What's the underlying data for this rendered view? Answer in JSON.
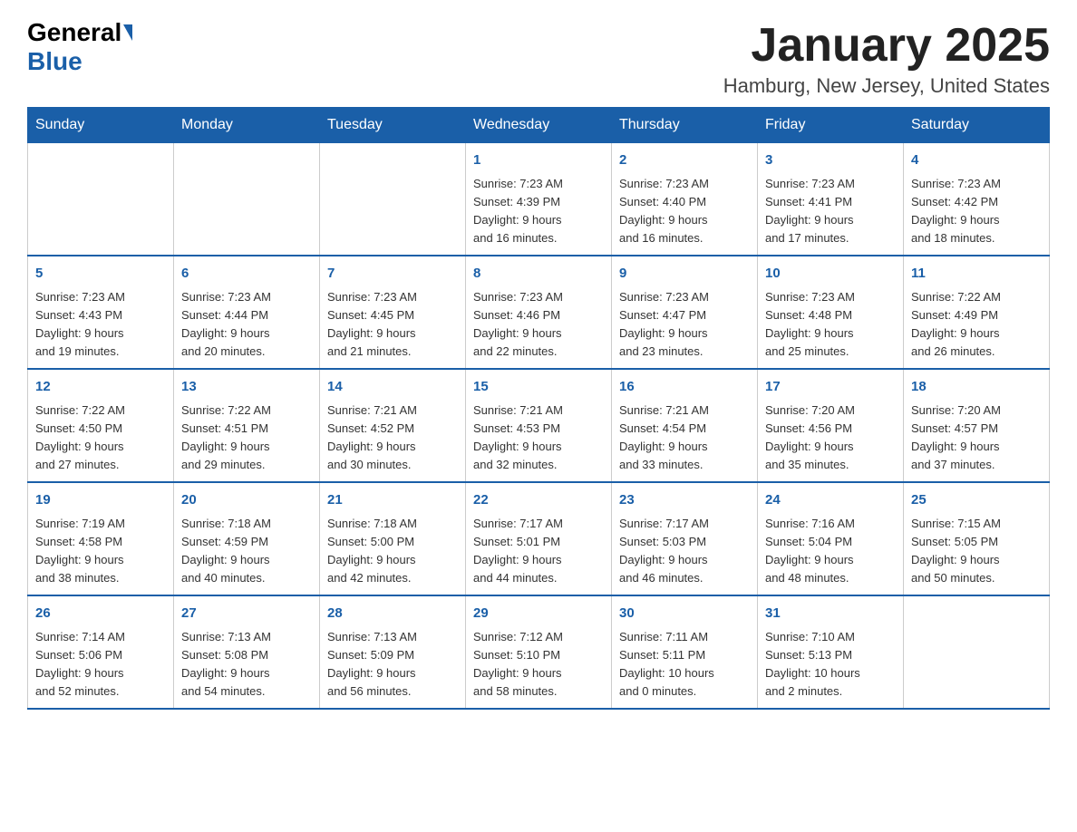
{
  "logo": {
    "general": "General",
    "blue": "Blue"
  },
  "header": {
    "month": "January 2025",
    "location": "Hamburg, New Jersey, United States"
  },
  "weekdays": [
    "Sunday",
    "Monday",
    "Tuesday",
    "Wednesday",
    "Thursday",
    "Friday",
    "Saturday"
  ],
  "weeks": [
    [
      {
        "day": "",
        "info": ""
      },
      {
        "day": "",
        "info": ""
      },
      {
        "day": "",
        "info": ""
      },
      {
        "day": "1",
        "info": "Sunrise: 7:23 AM\nSunset: 4:39 PM\nDaylight: 9 hours\nand 16 minutes."
      },
      {
        "day": "2",
        "info": "Sunrise: 7:23 AM\nSunset: 4:40 PM\nDaylight: 9 hours\nand 16 minutes."
      },
      {
        "day": "3",
        "info": "Sunrise: 7:23 AM\nSunset: 4:41 PM\nDaylight: 9 hours\nand 17 minutes."
      },
      {
        "day": "4",
        "info": "Sunrise: 7:23 AM\nSunset: 4:42 PM\nDaylight: 9 hours\nand 18 minutes."
      }
    ],
    [
      {
        "day": "5",
        "info": "Sunrise: 7:23 AM\nSunset: 4:43 PM\nDaylight: 9 hours\nand 19 minutes."
      },
      {
        "day": "6",
        "info": "Sunrise: 7:23 AM\nSunset: 4:44 PM\nDaylight: 9 hours\nand 20 minutes."
      },
      {
        "day": "7",
        "info": "Sunrise: 7:23 AM\nSunset: 4:45 PM\nDaylight: 9 hours\nand 21 minutes."
      },
      {
        "day": "8",
        "info": "Sunrise: 7:23 AM\nSunset: 4:46 PM\nDaylight: 9 hours\nand 22 minutes."
      },
      {
        "day": "9",
        "info": "Sunrise: 7:23 AM\nSunset: 4:47 PM\nDaylight: 9 hours\nand 23 minutes."
      },
      {
        "day": "10",
        "info": "Sunrise: 7:23 AM\nSunset: 4:48 PM\nDaylight: 9 hours\nand 25 minutes."
      },
      {
        "day": "11",
        "info": "Sunrise: 7:22 AM\nSunset: 4:49 PM\nDaylight: 9 hours\nand 26 minutes."
      }
    ],
    [
      {
        "day": "12",
        "info": "Sunrise: 7:22 AM\nSunset: 4:50 PM\nDaylight: 9 hours\nand 27 minutes."
      },
      {
        "day": "13",
        "info": "Sunrise: 7:22 AM\nSunset: 4:51 PM\nDaylight: 9 hours\nand 29 minutes."
      },
      {
        "day": "14",
        "info": "Sunrise: 7:21 AM\nSunset: 4:52 PM\nDaylight: 9 hours\nand 30 minutes."
      },
      {
        "day": "15",
        "info": "Sunrise: 7:21 AM\nSunset: 4:53 PM\nDaylight: 9 hours\nand 32 minutes."
      },
      {
        "day": "16",
        "info": "Sunrise: 7:21 AM\nSunset: 4:54 PM\nDaylight: 9 hours\nand 33 minutes."
      },
      {
        "day": "17",
        "info": "Sunrise: 7:20 AM\nSunset: 4:56 PM\nDaylight: 9 hours\nand 35 minutes."
      },
      {
        "day": "18",
        "info": "Sunrise: 7:20 AM\nSunset: 4:57 PM\nDaylight: 9 hours\nand 37 minutes."
      }
    ],
    [
      {
        "day": "19",
        "info": "Sunrise: 7:19 AM\nSunset: 4:58 PM\nDaylight: 9 hours\nand 38 minutes."
      },
      {
        "day": "20",
        "info": "Sunrise: 7:18 AM\nSunset: 4:59 PM\nDaylight: 9 hours\nand 40 minutes."
      },
      {
        "day": "21",
        "info": "Sunrise: 7:18 AM\nSunset: 5:00 PM\nDaylight: 9 hours\nand 42 minutes."
      },
      {
        "day": "22",
        "info": "Sunrise: 7:17 AM\nSunset: 5:01 PM\nDaylight: 9 hours\nand 44 minutes."
      },
      {
        "day": "23",
        "info": "Sunrise: 7:17 AM\nSunset: 5:03 PM\nDaylight: 9 hours\nand 46 minutes."
      },
      {
        "day": "24",
        "info": "Sunrise: 7:16 AM\nSunset: 5:04 PM\nDaylight: 9 hours\nand 48 minutes."
      },
      {
        "day": "25",
        "info": "Sunrise: 7:15 AM\nSunset: 5:05 PM\nDaylight: 9 hours\nand 50 minutes."
      }
    ],
    [
      {
        "day": "26",
        "info": "Sunrise: 7:14 AM\nSunset: 5:06 PM\nDaylight: 9 hours\nand 52 minutes."
      },
      {
        "day": "27",
        "info": "Sunrise: 7:13 AM\nSunset: 5:08 PM\nDaylight: 9 hours\nand 54 minutes."
      },
      {
        "day": "28",
        "info": "Sunrise: 7:13 AM\nSunset: 5:09 PM\nDaylight: 9 hours\nand 56 minutes."
      },
      {
        "day": "29",
        "info": "Sunrise: 7:12 AM\nSunset: 5:10 PM\nDaylight: 9 hours\nand 58 minutes."
      },
      {
        "day": "30",
        "info": "Sunrise: 7:11 AM\nSunset: 5:11 PM\nDaylight: 10 hours\nand 0 minutes."
      },
      {
        "day": "31",
        "info": "Sunrise: 7:10 AM\nSunset: 5:13 PM\nDaylight: 10 hours\nand 2 minutes."
      },
      {
        "day": "",
        "info": ""
      }
    ]
  ]
}
